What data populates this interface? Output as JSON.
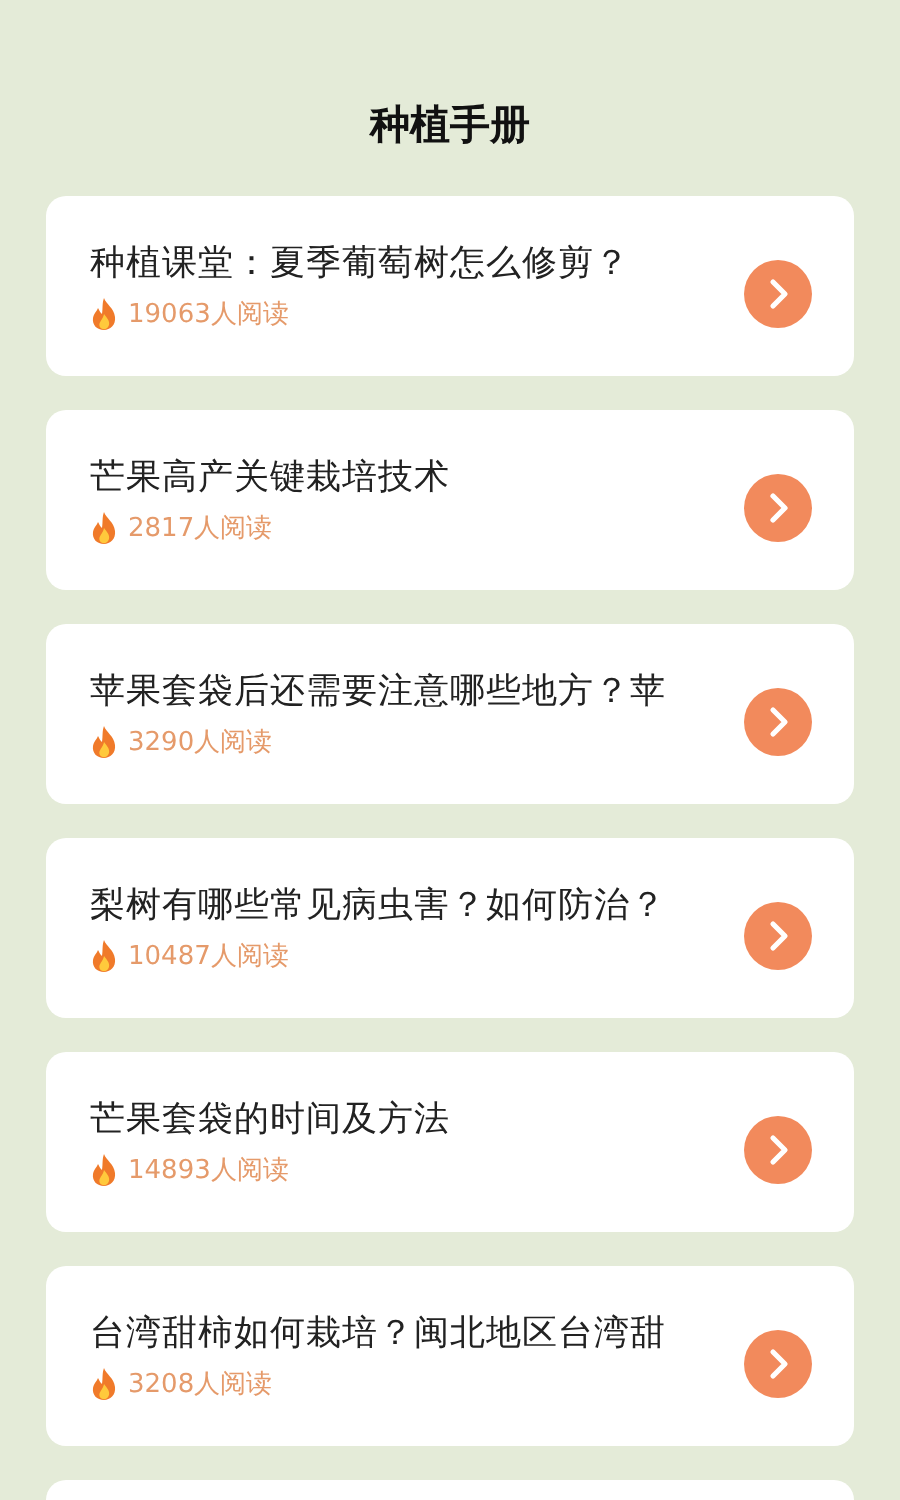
{
  "header": {
    "title": "种植手册"
  },
  "articles": [
    {
      "title": "种植课堂：夏季葡萄树怎么修剪？",
      "reads": "19063人阅读"
    },
    {
      "title": "芒果高产关键栽培技术",
      "reads": "2817人阅读"
    },
    {
      "title": "苹果套袋后还需要注意哪些地方？苹",
      "reads": "3290人阅读"
    },
    {
      "title": "梨树有哪些常见病虫害？如何防治？",
      "reads": "10487人阅读"
    },
    {
      "title": "芒果套袋的时间及方法",
      "reads": "14893人阅读"
    },
    {
      "title": "台湾甜柿如何栽培？闽北地区台湾甜",
      "reads": "3208人阅读"
    }
  ]
}
